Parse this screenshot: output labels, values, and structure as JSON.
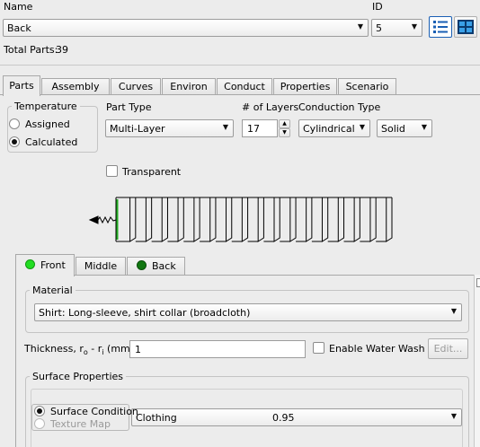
{
  "header": {
    "name_label": "Name",
    "name_value": "Back",
    "id_label": "ID",
    "id_value": "5",
    "total_parts_label": "Total Parts:",
    "total_parts_value": "39"
  },
  "tabs": [
    {
      "label": "Parts"
    },
    {
      "label": "Assembly"
    },
    {
      "label": "Curves"
    },
    {
      "label": "Environ"
    },
    {
      "label": "Conduct"
    },
    {
      "label": "Properties"
    },
    {
      "label": "Scenario"
    }
  ],
  "temperature": {
    "title": "Temperature",
    "options": [
      "Assigned",
      "Calculated"
    ],
    "selected": "Calculated"
  },
  "part_type": {
    "label": "Part Type",
    "value": "Multi-Layer"
  },
  "layers": {
    "label": "# of Layers",
    "value": "17"
  },
  "conduction": {
    "label": "Conduction Type",
    "type_value": "Cylindrical",
    "mode_value": "Solid"
  },
  "transparent": {
    "label": "Transparent",
    "checked": false
  },
  "subtabs": [
    {
      "label": "Front",
      "dot_color": "#22dd22"
    },
    {
      "label": "Middle"
    },
    {
      "label": "Back",
      "dot_color": "#117711"
    }
  ],
  "material": {
    "title": "Material",
    "value": "Shirt: Long-sleeve, shirt collar (broadcloth)"
  },
  "thickness": {
    "label_prefix": "Thickness, r",
    "label_sub1": "o",
    "label_mid": " - r",
    "label_sub2": "i",
    "label_suffix": " (mm)",
    "value": "1"
  },
  "water_wash": {
    "label": "Enable Water Wash",
    "checked": false
  },
  "edit_button": {
    "label": "Edit..."
  },
  "surface": {
    "title": "Surface Properties",
    "options": [
      "Surface Condition",
      "Texture Map"
    ],
    "selected": "Surface Condition",
    "condition_value": "Clothing",
    "condition_number": "0.95"
  },
  "colors": {
    "accent_blue": "#1a5fb4",
    "front_green": "#22dd22",
    "back_green": "#117711"
  }
}
